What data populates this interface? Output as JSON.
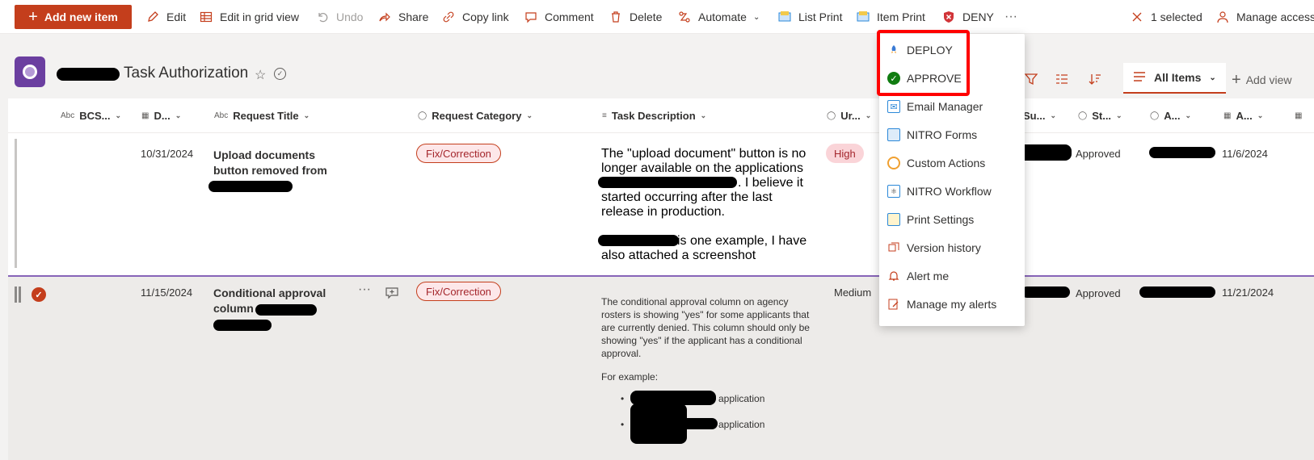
{
  "commandbar": {
    "add_new_item": "Add new item",
    "edit": "Edit",
    "edit_grid": "Edit in grid view",
    "undo": "Undo",
    "share": "Share",
    "copy_link": "Copy link",
    "comment": "Comment",
    "delete": "Delete",
    "automate": "Automate",
    "list_print": "List Print",
    "item_print": "Item Print",
    "deny": "DENY",
    "more": "···",
    "selected": "1 selected",
    "manage_access": "Manage access"
  },
  "header": {
    "list_title": "Task Authorization",
    "view_name": "All Items",
    "add_view": "Add view"
  },
  "columns": [
    {
      "label": "BCS..."
    },
    {
      "label": "D..."
    },
    {
      "label": "Request Title"
    },
    {
      "label": "Request Category"
    },
    {
      "label": "Task Description"
    },
    {
      "label": "Ur..."
    },
    {
      "label": "Su..."
    },
    {
      "label": "St..."
    },
    {
      "label": "A..."
    },
    {
      "label": "A..."
    }
  ],
  "rows": [
    {
      "date": "10/31/2024",
      "title_line1": "Upload documents",
      "title_line2": "button removed from",
      "category": "Fix/Correction",
      "desc_p1_l1": "The \"upload document\" button is no",
      "desc_p1_l2": "longer available on the applications",
      "desc_p1_l3": ". I believe it",
      "desc_p1_l4": "started occurring after the last",
      "desc_p1_l5": "release in production.",
      "desc_p2_l1": "is one example, I have",
      "desc_p2_l2": "also attached a screenshot",
      "urgency": "High",
      "status": "Approved",
      "approved_date": "11/6/2024"
    },
    {
      "date": "11/15/2024",
      "title_line1": "Conditional approval",
      "title_line2": "column",
      "category": "Fix/Correction",
      "desc_l1": "The conditional approval column on agency",
      "desc_l2": "rosters is showing \"yes\" for some applicants that",
      "desc_l3": "are currently denied. This column should only be",
      "desc_l4": "showing \"yes\" if the applicant has a conditional",
      "desc_l5": "approval.",
      "desc_example": "For example:",
      "bullet1": "application",
      "bullet2": "application",
      "urgency": "Medium",
      "status": "Approved",
      "approved_date": "11/21/2024"
    }
  ],
  "menu": {
    "items": [
      {
        "label": "DEPLOY",
        "icon": "rocket-icon"
      },
      {
        "label": "APPROVE",
        "icon": "green-check-icon"
      },
      {
        "label": "Email Manager",
        "icon": "email-manager-icon"
      },
      {
        "label": "NITRO Forms",
        "icon": "nitro-forms-icon"
      },
      {
        "label": "Custom Actions",
        "icon": "custom-actions-icon"
      },
      {
        "label": "NITRO Workflow",
        "icon": "nitro-workflow-icon"
      },
      {
        "label": "Print Settings",
        "icon": "print-settings-icon"
      },
      {
        "label": "Version history",
        "icon": "version-history-icon"
      },
      {
        "label": "Alert me",
        "icon": "bell-icon"
      },
      {
        "label": "Manage my alerts",
        "icon": "manage-alerts-icon"
      }
    ]
  },
  "colors": {
    "accent": "#c43e1c",
    "highlight": "#ff0000",
    "selected_row_border": "#8764b8"
  }
}
